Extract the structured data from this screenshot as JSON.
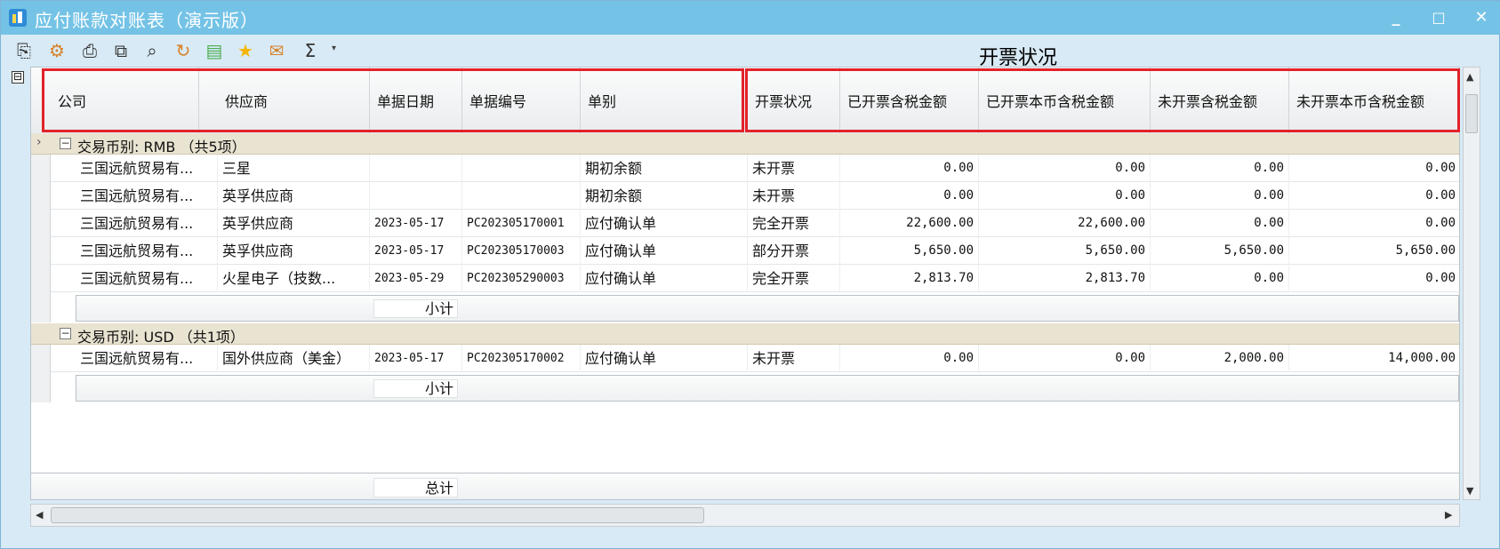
{
  "window": {
    "title": "应付账款对账表（演示版）",
    "minimize": "_",
    "maximize": "□",
    "close": "✕"
  },
  "toolbar": {
    "icons": [
      "export-icon",
      "refresh-filter-icon",
      "print-icon",
      "print-preview-icon",
      "find-icon",
      "reload-icon",
      "save-icon",
      "favorite-icon",
      "mail-icon",
      "sum-icon"
    ],
    "dropdown": "▾"
  },
  "annotation": {
    "label": "开票状况"
  },
  "grid": {
    "collapse_all": "⊟",
    "columns": [
      "公司",
      "供应商",
      "单据日期",
      "单据编号",
      "单别",
      "开票状况",
      "已开票含税金额",
      "已开票本币含税金额",
      "未开票含税金额",
      "未开票本币含税金额"
    ],
    "groups": [
      {
        "label": "交易币别: RMB （共5项）",
        "rows": [
          [
            "三国远航贸易有...",
            "三星",
            "",
            "",
            "期初余额",
            "未开票",
            "0.00",
            "0.00",
            "0.00",
            "0.00"
          ],
          [
            "三国远航贸易有...",
            "英孚供应商",
            "",
            "",
            "期初余额",
            "未开票",
            "0.00",
            "0.00",
            "0.00",
            "0.00"
          ],
          [
            "三国远航贸易有...",
            "英孚供应商",
            "2023-05-17",
            "PC202305170001",
            "应付确认单",
            "完全开票",
            "22,600.00",
            "22,600.00",
            "0.00",
            "0.00"
          ],
          [
            "三国远航贸易有...",
            "英孚供应商",
            "2023-05-17",
            "PC202305170003",
            "应付确认单",
            "部分开票",
            "5,650.00",
            "5,650.00",
            "5,650.00",
            "5,650.00"
          ],
          [
            "三国远航贸易有...",
            "火星电子（技数...",
            "2023-05-29",
            "PC202305290003",
            "应付确认单",
            "完全开票",
            "2,813.70",
            "2,813.70",
            "0.00",
            "0.00"
          ]
        ],
        "subtotal": "小计"
      },
      {
        "label": "交易币别: USD （共1项）",
        "rows": [
          [
            "三国远航贸易有...",
            "国外供应商（美金）",
            "2023-05-17",
            "PC202305170002",
            "应付确认单",
            "未开票",
            "0.00",
            "0.00",
            "2,000.00",
            "14,000.00"
          ]
        ],
        "subtotal": "小计"
      }
    ],
    "total": "总计"
  },
  "scrollbars": {
    "up": "▲",
    "down": "▼",
    "left": "◀",
    "right": "▶"
  }
}
